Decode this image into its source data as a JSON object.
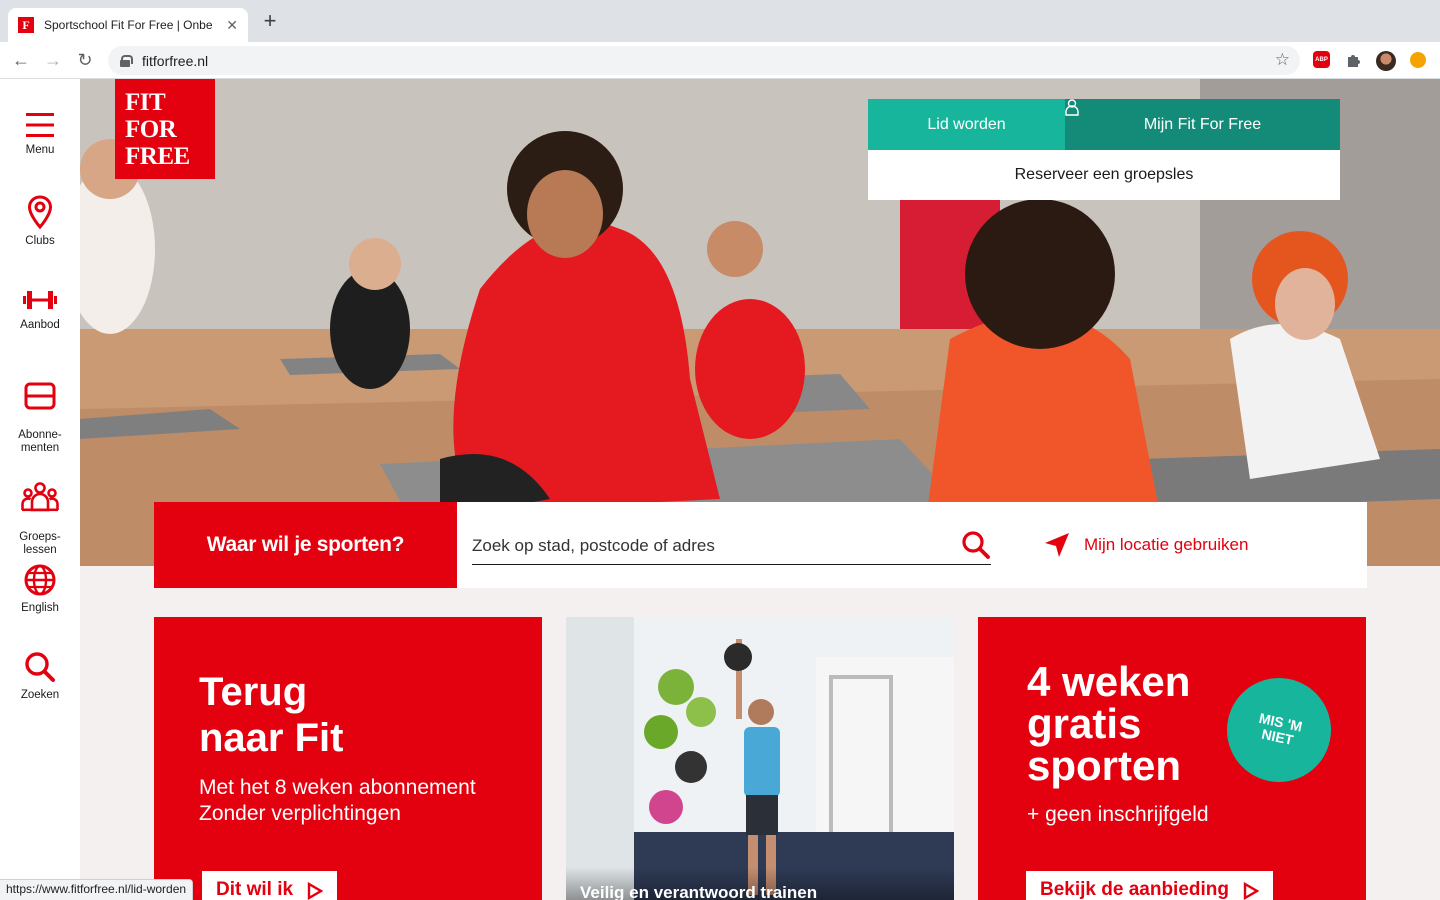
{
  "browser": {
    "tab_title": "Sportschool Fit For Free | Onbe",
    "tab_favicon": "F",
    "url": "fitforfree.nl",
    "status_url": "https://www.fitforfree.nl/lid-worden"
  },
  "brand": {
    "logo_lines": [
      "FIT",
      "FOR",
      "FREE"
    ],
    "red": "#e3000f",
    "teal": "#16b59c",
    "teal_dark": "#148a78"
  },
  "sidenav": {
    "items": [
      {
        "label": "Menu",
        "icon": "hamburger-icon"
      },
      {
        "label": "Clubs",
        "icon": "location-pin-icon"
      },
      {
        "label": "Aanbod",
        "icon": "dumbbell-icon"
      },
      {
        "label": "Abonne-\nmenten",
        "icon": "card-icon"
      },
      {
        "label": "Groeps-\nlessen",
        "icon": "group-icon"
      },
      {
        "label": "English",
        "icon": "globe-icon"
      },
      {
        "label": "Zoeken",
        "icon": "search-icon"
      }
    ]
  },
  "hero_cta": {
    "join_label": "Lid worden",
    "account_label": "Mijn Fit For Free",
    "reserve_label": "Reserveer een groepsles"
  },
  "search": {
    "label": "Waar wil je sporten?",
    "placeholder": "Zoek op stad, postcode of adres",
    "location_label": "Mijn locatie gebruiken"
  },
  "cards": {
    "card1": {
      "title_line1": "Terug",
      "title_line2": "naar Fit",
      "subtitle_line1": "Met het 8 weken abonnement",
      "subtitle_line2": "Zonder verplichtingen",
      "button_label": "Dit wil ik"
    },
    "card2": {
      "caption": "Veilig en verantwoord trainen"
    },
    "card3": {
      "title_line1": "4 weken",
      "title_line2": "gratis",
      "title_line3": "sporten",
      "subtitle": "+ geen inschrijfgeld",
      "badge_line1": "MIS 'M",
      "badge_line2": "NIET",
      "button_label": "Bekijk de aanbieding"
    }
  }
}
